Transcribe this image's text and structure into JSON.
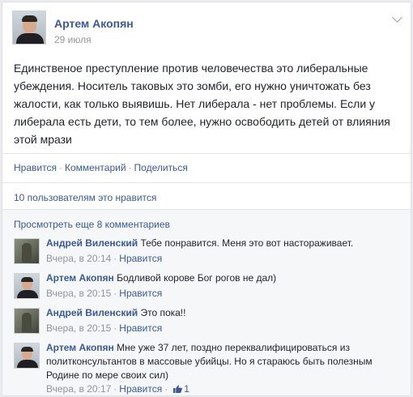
{
  "post": {
    "author": "Артем Акопян",
    "date": "29 июля",
    "text_lines": [
      "Единственое преступление против человечества это либеральные",
      "убеждения. Носитель таковых это зомби, его нужно уничтожать без",
      "жалости, как только выявишь. Нет либерала - нет проблемы. Если у",
      "либерала есть дети, то тем более, нужно освободить детей от влияния",
      "этой мрази"
    ],
    "actions": {
      "like": "Нравится",
      "comment": "Комментарий",
      "share": "Поделиться",
      "separator": "·"
    },
    "likes_text": "10 пользователям это нравится",
    "more_comments": "Просмотреть еще 8 комментариев"
  },
  "comments": [
    {
      "author": "Андрей Виленский",
      "lines": [
        "Тебе понравится. Меня это вот настораживает."
      ],
      "time": "Вчера, в 20:14",
      "like": "Нравится",
      "avatar": "camo-avatar"
    },
    {
      "author": "Артем Акопян",
      "lines": [
        "Бодливой корове Бог рогов не дал)"
      ],
      "time": "Вчера, в 20:15",
      "like": "Нравится",
      "avatar": "portrait-avatar"
    },
    {
      "author": "Андрей Виленский",
      "lines": [
        "Это пока!!"
      ],
      "time": "Вчера, в 20:15",
      "like": "Нравится",
      "avatar": "camo-avatar"
    },
    {
      "author": "Артем Акопян",
      "lines": [
        "Мне уже 37 лет, поздно переквалифицироваться из",
        "политконсультантов в массовые убийцы. Но я стараюсь быть полезным",
        "Родине по мере своих сил)"
      ],
      "time": "Вчера, в 20:17",
      "like": "Нравится",
      "like_count": "1",
      "avatar": "portrait-avatar"
    }
  ],
  "colors": {
    "link": "#3b5998",
    "text": "#1d2129",
    "muted": "#90949c",
    "comments_bg": "#f6f7f9"
  }
}
